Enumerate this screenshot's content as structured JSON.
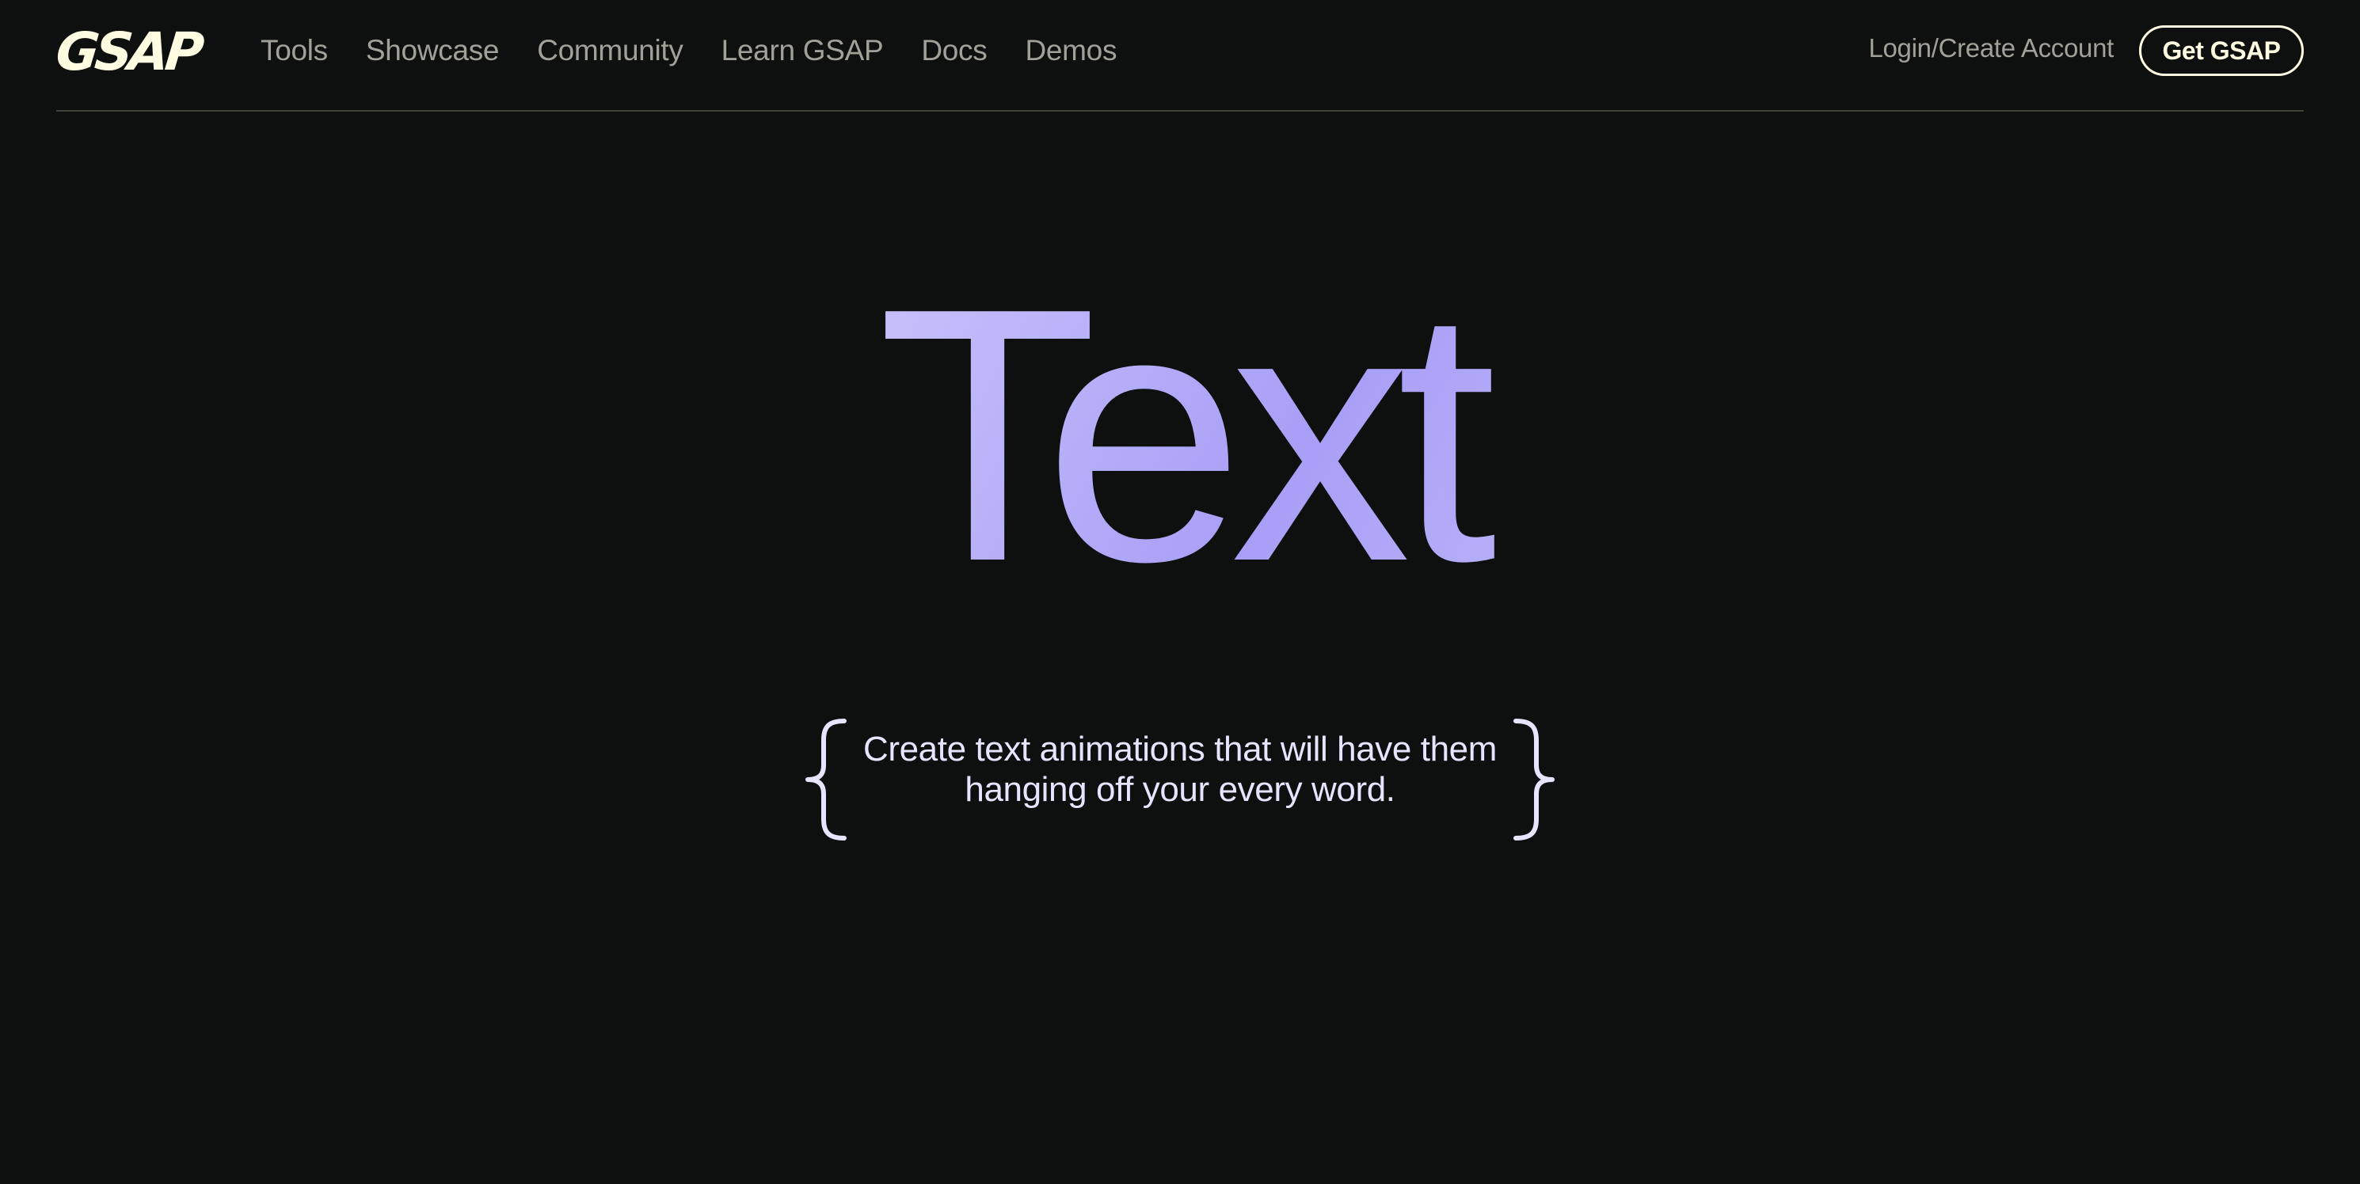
{
  "header": {
    "logo_text": "GSAP",
    "nav_items": [
      {
        "label": "Tools"
      },
      {
        "label": "Showcase"
      },
      {
        "label": "Community"
      },
      {
        "label": "Learn GSAP"
      },
      {
        "label": "Docs"
      },
      {
        "label": "Demos"
      }
    ],
    "login_label": "Login/Create Account",
    "cta_label": "Get GSAP"
  },
  "hero": {
    "title": "Text",
    "tagline_line1": "Create text animations that will have them",
    "tagline_line2": "hanging off your every word."
  },
  "colors": {
    "background": "#0e100f",
    "brand_cream": "#fffce1",
    "nav_gray": "#a2a199",
    "accent_purple": "#9d95ff",
    "accent_lavender": "#e6e4ff"
  },
  "icons": {
    "left_brace": "left-curly-brace-icon",
    "right_brace": "right-curly-brace-icon"
  }
}
